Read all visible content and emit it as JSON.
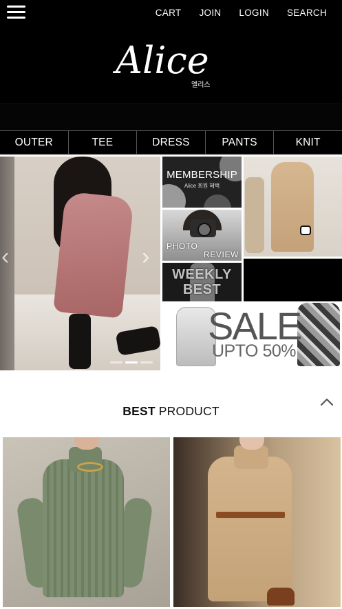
{
  "header": {
    "menu_icon": "hamburger-menu-icon",
    "links": [
      "CART",
      "JOIN",
      "LOGIN",
      "SEARCH"
    ],
    "logo_text": "Alice",
    "logo_sub": "엘리스"
  },
  "categories": [
    "OUTER",
    "TEE",
    "DRESS",
    "PANTS",
    "KNIT"
  ],
  "banner": {
    "slider_prev_icon": "chevron-left-icon",
    "slider_next_icon": "chevron-right-icon",
    "slide_count": 3,
    "active_slide": 2,
    "membership_title": "MEMBERSHIP",
    "membership_sub": "Alice 회원 혜택",
    "photo_review_line1": "PHOTO",
    "photo_review_line2": "REVIEW",
    "weekly_line1": "WEEKLY",
    "weekly_line2": "BEST",
    "sale_title": "SALE",
    "sale_sub": "UPTO 50%"
  },
  "best": {
    "title_bold": "BEST",
    "title_rest": " PRODUCT",
    "scroll_top_icon": "chevron-up-icon"
  },
  "colors": {
    "header_bg": "#000000",
    "text_light": "#ffffff",
    "text_dark": "#111111"
  }
}
